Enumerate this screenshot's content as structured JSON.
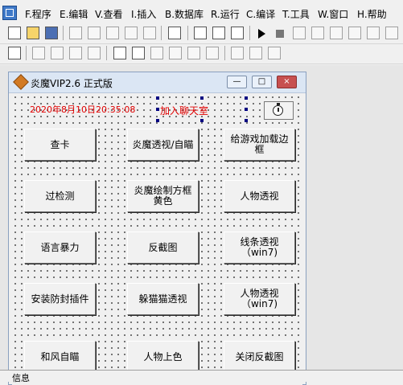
{
  "menubar": {
    "items": [
      {
        "label": "F.程序"
      },
      {
        "label": "E.编辑"
      },
      {
        "label": "V.查看"
      },
      {
        "label": "I.插入"
      },
      {
        "label": "B.数据库"
      },
      {
        "label": "R.运行"
      },
      {
        "label": "C.编译"
      },
      {
        "label": "T.工具"
      },
      {
        "label": "W.窗口"
      },
      {
        "label": "H.帮助"
      }
    ]
  },
  "form": {
    "title": "炎魔VIP2.6 正式版",
    "minimize_glyph": "—",
    "maximize_glyph": "□",
    "close_glyph": "×",
    "datetime": "2020年8月10日20:35:08",
    "join_chat_label": "加入聊天室",
    "buttons": [
      {
        "label": "查卡"
      },
      {
        "label": "炎魔透视/自瞄"
      },
      {
        "label": "给游戏加载边框"
      },
      {
        "label": "过检测"
      },
      {
        "label": "炎魔绘制方框黄色"
      },
      {
        "label": "人物透视"
      },
      {
        "label": "语言暴力"
      },
      {
        "label": "反截图"
      },
      {
        "label": "线条透视（win7)"
      },
      {
        "label": "安装防封插件"
      },
      {
        "label": "躲猫猫透视"
      },
      {
        "label": "人物透视（win7)"
      },
      {
        "label": "和风自瞄"
      },
      {
        "label": "人物上色"
      },
      {
        "label": "关闭反截图"
      }
    ]
  },
  "statusbar": {
    "text": "信息"
  }
}
